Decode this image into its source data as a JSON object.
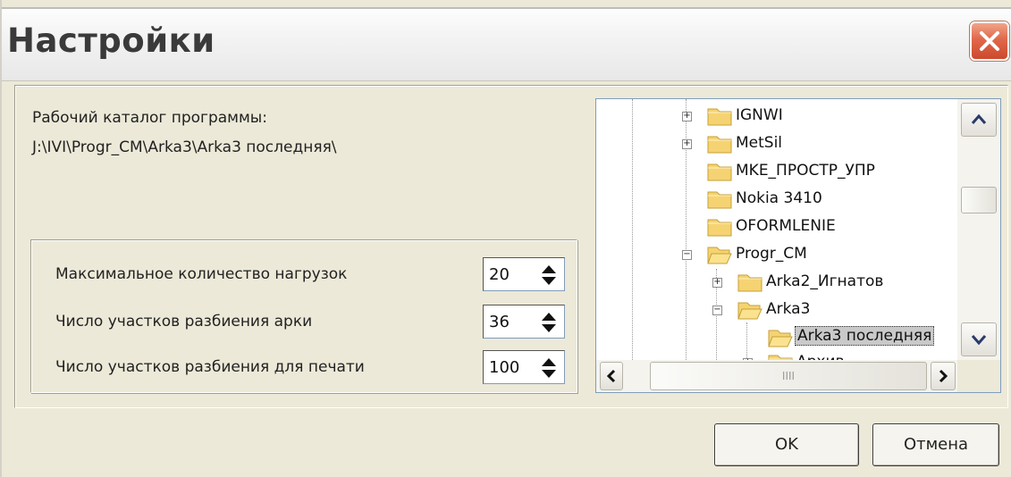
{
  "window": {
    "title": "Настройки"
  },
  "working_dir": {
    "label": "Рабочий каталог программы:",
    "path": "J:\\IVI\\Progr_CM\\Arka3\\Arka3 последняя\\"
  },
  "settings": [
    {
      "label": "Максимальное количество нагрузок",
      "value": "20"
    },
    {
      "label": "Число участков разбиения арки",
      "value": "36"
    },
    {
      "label": "Число участков разбиения для печати",
      "value": "100"
    }
  ],
  "tree": {
    "items": [
      {
        "label": "IGNWI",
        "expander": "+"
      },
      {
        "label": "MetSil",
        "expander": "+"
      },
      {
        "label": "MKE_ПРОСТР_УПР",
        "expander": ""
      },
      {
        "label": "Nokia 3410",
        "expander": ""
      },
      {
        "label": "OFORMLENIE",
        "expander": ""
      },
      {
        "label": "Progr_CM",
        "expander": "−"
      },
      {
        "label": "Arka2_Игнатов",
        "expander": "+"
      },
      {
        "label": "Arka3",
        "expander": "−"
      },
      {
        "label": "Arka3 последняя",
        "expander": "",
        "selected": true
      },
      {
        "label": "Архив",
        "expander": "+"
      }
    ],
    "scroll_grip": "IIII"
  },
  "buttons": {
    "ok": "OK",
    "cancel": "Отмена"
  }
}
